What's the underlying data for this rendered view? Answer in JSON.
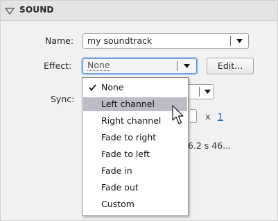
{
  "header": {
    "title": "SOUND"
  },
  "name_field": {
    "label": "Name:",
    "value": "my soundtrack"
  },
  "effect_field": {
    "label": "Effect:",
    "value": "None",
    "edit_label": "Edit..."
  },
  "sync_field": {
    "label": "Sync:"
  },
  "repeat": {
    "times_label": "x",
    "count": "1"
  },
  "info_text": "66.2 s 46...",
  "effect_menu": {
    "items": [
      {
        "label": "None",
        "checked": true
      },
      {
        "label": "Left channel",
        "highlighted": true
      },
      {
        "label": "Right channel"
      },
      {
        "label": "Fade to right"
      },
      {
        "label": "Fade to left"
      },
      {
        "label": "Fade in"
      },
      {
        "label": "Fade out"
      },
      {
        "label": "Custom"
      }
    ]
  }
}
